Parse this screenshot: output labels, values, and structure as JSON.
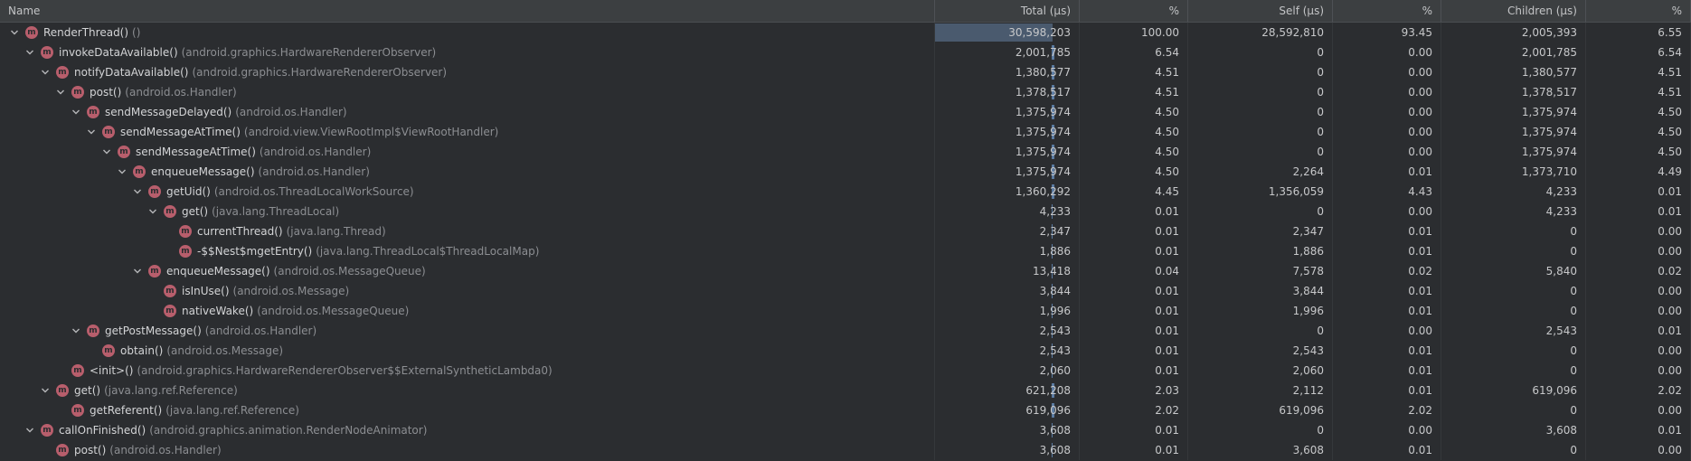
{
  "header": {
    "name": "Name",
    "total": "Total (µs)",
    "total_pct": "%",
    "self": "Self (µs)",
    "self_pct": "%",
    "children": "Children (µs)",
    "children_pct": "%"
  },
  "method_icon_letter": "m",
  "colors": {
    "background": "#2b2d30",
    "method_icon": "#b85e6c",
    "total_bar": "#4a5a6e"
  },
  "rows": [
    {
      "depth": 0,
      "expanded": true,
      "method": "RenderThread()",
      "cls": "()",
      "total": "30,598,203",
      "total_pct": "100.00",
      "self": "28,592,810",
      "self_pct": "93.45",
      "children": "2,005,393",
      "children_pct": "6.55",
      "bar_fraction": 1.0
    },
    {
      "depth": 1,
      "expanded": true,
      "method": "invokeDataAvailable()",
      "cls": "(android.graphics.HardwareRendererObserver)",
      "total": "2,001,785",
      "total_pct": "6.54",
      "self": "0",
      "self_pct": "0.00",
      "children": "2,001,785",
      "children_pct": "6.54",
      "bar_fraction": 0.0654
    },
    {
      "depth": 2,
      "expanded": true,
      "method": "notifyDataAvailable()",
      "cls": "(android.graphics.HardwareRendererObserver)",
      "total": "1,380,577",
      "total_pct": "4.51",
      "self": "0",
      "self_pct": "0.00",
      "children": "1,380,577",
      "children_pct": "4.51",
      "bar_fraction": 0.0451
    },
    {
      "depth": 3,
      "expanded": true,
      "method": "post()",
      "cls": "(android.os.Handler)",
      "total": "1,378,517",
      "total_pct": "4.51",
      "self": "0",
      "self_pct": "0.00",
      "children": "1,378,517",
      "children_pct": "4.51",
      "bar_fraction": 0.0451
    },
    {
      "depth": 4,
      "expanded": true,
      "method": "sendMessageDelayed()",
      "cls": "(android.os.Handler)",
      "total": "1,375,974",
      "total_pct": "4.50",
      "self": "0",
      "self_pct": "0.00",
      "children": "1,375,974",
      "children_pct": "4.50",
      "bar_fraction": 0.045
    },
    {
      "depth": 5,
      "expanded": true,
      "method": "sendMessageAtTime()",
      "cls": "(android.view.ViewRootImpl$ViewRootHandler)",
      "total": "1,375,974",
      "total_pct": "4.50",
      "self": "0",
      "self_pct": "0.00",
      "children": "1,375,974",
      "children_pct": "4.50",
      "bar_fraction": 0.045
    },
    {
      "depth": 6,
      "expanded": true,
      "method": "sendMessageAtTime()",
      "cls": "(android.os.Handler)",
      "total": "1,375,974",
      "total_pct": "4.50",
      "self": "0",
      "self_pct": "0.00",
      "children": "1,375,974",
      "children_pct": "4.50",
      "bar_fraction": 0.045
    },
    {
      "depth": 7,
      "expanded": true,
      "method": "enqueueMessage()",
      "cls": "(android.os.Handler)",
      "total": "1,375,974",
      "total_pct": "4.50",
      "self": "2,264",
      "self_pct": "0.01",
      "children": "1,373,710",
      "children_pct": "4.49",
      "bar_fraction": 0.045
    },
    {
      "depth": 8,
      "expanded": true,
      "method": "getUid()",
      "cls": "(android.os.ThreadLocalWorkSource)",
      "total": "1,360,292",
      "total_pct": "4.45",
      "self": "1,356,059",
      "self_pct": "4.43",
      "children": "4,233",
      "children_pct": "0.01",
      "bar_fraction": 0.0445
    },
    {
      "depth": 9,
      "expanded": true,
      "method": "get()",
      "cls": "(java.lang.ThreadLocal)",
      "total": "4,233",
      "total_pct": "0.01",
      "self": "0",
      "self_pct": "0.00",
      "children": "4,233",
      "children_pct": "0.01",
      "bar_fraction": 0.0001
    },
    {
      "depth": 10,
      "expanded": null,
      "method": "currentThread()",
      "cls": "(java.lang.Thread)",
      "total": "2,347",
      "total_pct": "0.01",
      "self": "2,347",
      "self_pct": "0.01",
      "children": "0",
      "children_pct": "0.00",
      "bar_fraction": 0.0001
    },
    {
      "depth": 10,
      "expanded": null,
      "method": "-$$Nest$mgetEntry()",
      "cls": "(java.lang.ThreadLocal$ThreadLocalMap)",
      "total": "1,886",
      "total_pct": "0.01",
      "self": "1,886",
      "self_pct": "0.01",
      "children": "0",
      "children_pct": "0.00",
      "bar_fraction": 0.0001
    },
    {
      "depth": 8,
      "expanded": true,
      "method": "enqueueMessage()",
      "cls": "(android.os.MessageQueue)",
      "total": "13,418",
      "total_pct": "0.04",
      "self": "7,578",
      "self_pct": "0.02",
      "children": "5,840",
      "children_pct": "0.02",
      "bar_fraction": 0.0004
    },
    {
      "depth": 9,
      "expanded": null,
      "method": "isInUse()",
      "cls": "(android.os.Message)",
      "total": "3,844",
      "total_pct": "0.01",
      "self": "3,844",
      "self_pct": "0.01",
      "children": "0",
      "children_pct": "0.00",
      "bar_fraction": 0.0001
    },
    {
      "depth": 9,
      "expanded": null,
      "method": "nativeWake()",
      "cls": "(android.os.MessageQueue)",
      "total": "1,996",
      "total_pct": "0.01",
      "self": "1,996",
      "self_pct": "0.01",
      "children": "0",
      "children_pct": "0.00",
      "bar_fraction": 0.0001
    },
    {
      "depth": 4,
      "expanded": true,
      "method": "getPostMessage()",
      "cls": "(android.os.Handler)",
      "total": "2,543",
      "total_pct": "0.01",
      "self": "0",
      "self_pct": "0.00",
      "children": "2,543",
      "children_pct": "0.01",
      "bar_fraction": 0.0001
    },
    {
      "depth": 5,
      "expanded": null,
      "method": "obtain()",
      "cls": "(android.os.Message)",
      "total": "2,543",
      "total_pct": "0.01",
      "self": "2,543",
      "self_pct": "0.01",
      "children": "0",
      "children_pct": "0.00",
      "bar_fraction": 0.0001
    },
    {
      "depth": 3,
      "expanded": null,
      "method": "<init>()",
      "cls": "(android.graphics.HardwareRendererObserver$$ExternalSyntheticLambda0)",
      "total": "2,060",
      "total_pct": "0.01",
      "self": "2,060",
      "self_pct": "0.01",
      "children": "0",
      "children_pct": "0.00",
      "bar_fraction": 0.0001
    },
    {
      "depth": 2,
      "expanded": true,
      "method": "get()",
      "cls": "(java.lang.ref.Reference)",
      "total": "621,208",
      "total_pct": "2.03",
      "self": "2,112",
      "self_pct": "0.01",
      "children": "619,096",
      "children_pct": "2.02",
      "bar_fraction": 0.0203
    },
    {
      "depth": 3,
      "expanded": null,
      "method": "getReferent()",
      "cls": "(java.lang.ref.Reference)",
      "total": "619,096",
      "total_pct": "2.02",
      "self": "619,096",
      "self_pct": "2.02",
      "children": "0",
      "children_pct": "0.00",
      "bar_fraction": 0.0202
    },
    {
      "depth": 1,
      "expanded": true,
      "method": "callOnFinished()",
      "cls": "(android.graphics.animation.RenderNodeAnimator)",
      "total": "3,608",
      "total_pct": "0.01",
      "self": "0",
      "self_pct": "0.00",
      "children": "3,608",
      "children_pct": "0.01",
      "bar_fraction": 0.0001
    },
    {
      "depth": 2,
      "expanded": null,
      "method": "post()",
      "cls": "(android.os.Handler)",
      "total": "3,608",
      "total_pct": "0.01",
      "self": "3,608",
      "self_pct": "0.01",
      "children": "0",
      "children_pct": "0.00",
      "bar_fraction": 0.0001
    }
  ]
}
